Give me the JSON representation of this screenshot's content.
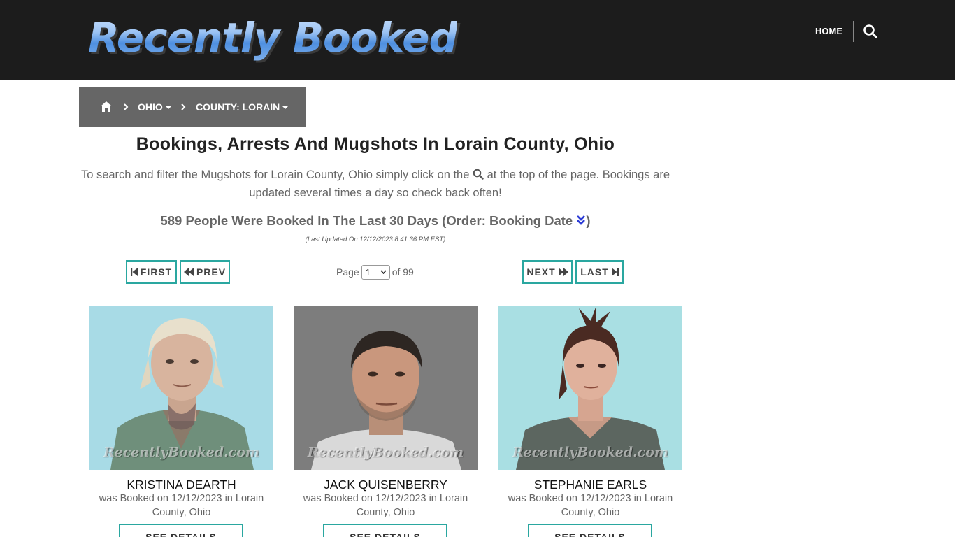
{
  "header": {
    "logo_text": "Recently Booked",
    "nav_home": "HOME"
  },
  "breadcrumb": {
    "state": "OHIO",
    "county": "COUNTY: LORAIN"
  },
  "main": {
    "title": "Bookings, Arrests And Mugshots In Lorain County, Ohio",
    "intro_before": "To search and filter the Mugshots for Lorain County, Ohio simply click on the",
    "intro_after": "at the top of the page. Bookings are updated several times a day so check back often!",
    "count_text": "589 People Were Booked In The Last 30 Days (Order: Booking Date",
    "count_close": ")",
    "last_updated": "(Last Updated On 12/12/2023 8:41:36 PM EST)"
  },
  "pagination": {
    "first": "FIRST",
    "prev": "PREV",
    "next": "NEXT",
    "last": "LAST",
    "page_label": "Page",
    "page_value": "1",
    "of_label": "of 99"
  },
  "watermark": "RecentlyBooked.com",
  "bookings": [
    {
      "name": "KRISTINA DEARTH",
      "booked": "was Booked on 12/12/2023 in Lorain County, Ohio",
      "button": "SEE DETAILS"
    },
    {
      "name": "JACK QUISENBERRY",
      "booked": "was Booked on 12/12/2023 in Lorain County, Ohio",
      "button": "SEE DETAILS"
    },
    {
      "name": "STEPHANIE EARLS",
      "booked": "was Booked on 12/12/2023 in Lorain County, Ohio",
      "button": "SEE DETAILS"
    }
  ],
  "colors": {
    "header_bg": "#1c1c1c",
    "breadcrumb_bg": "#666666",
    "accent_teal": "#2aa7a0",
    "sort_icon_blue": "#2b3bd6"
  },
  "icons": {
    "search": "search-icon",
    "home": "home-icon",
    "sort": "sort-desc-icon"
  }
}
